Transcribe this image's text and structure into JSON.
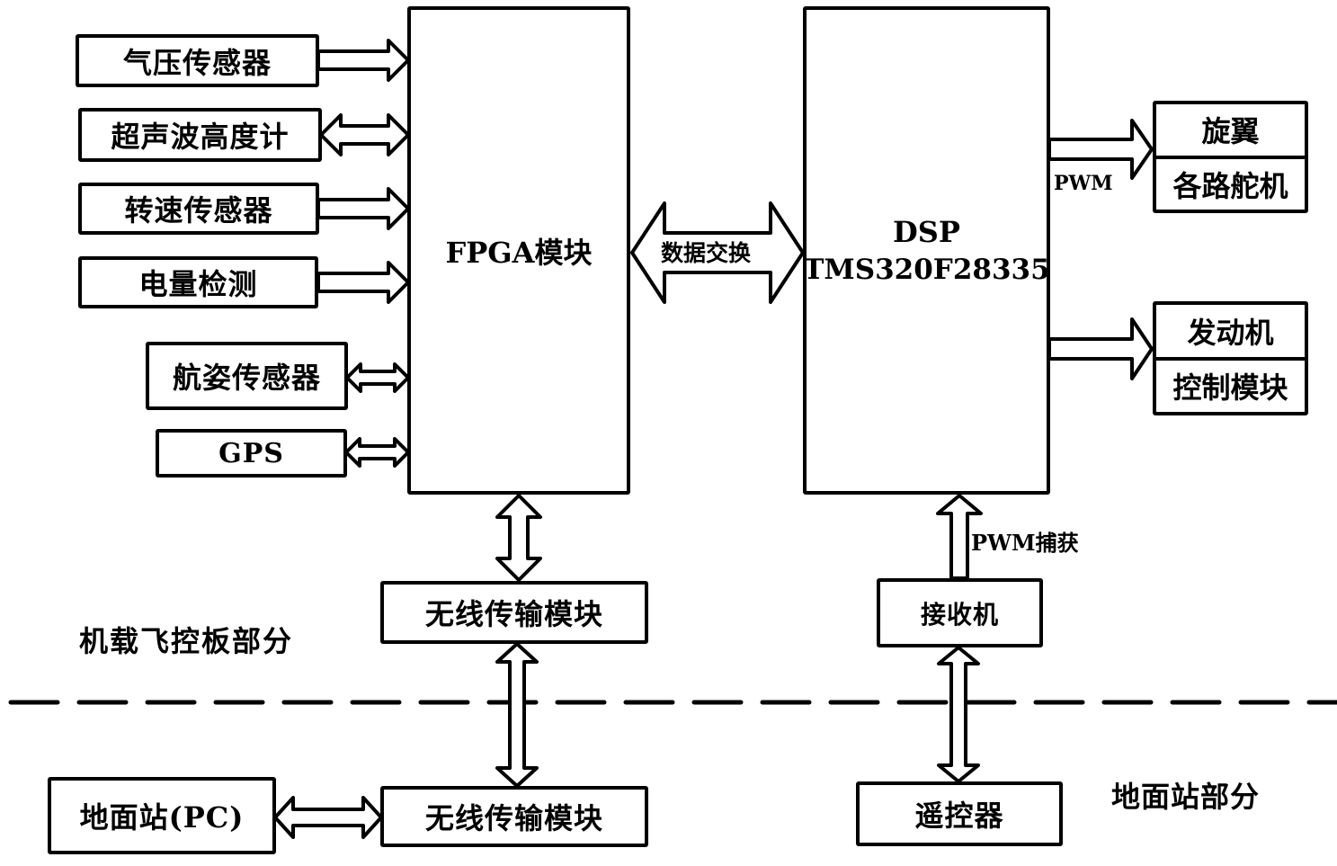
{
  "sections": {
    "onboard": "机载飞控板部分",
    "ground": "地面站部分"
  },
  "sensors": [
    {
      "label": "气压传感器",
      "link": "input"
    },
    {
      "label": "超声波高度计",
      "link": "bidirectional"
    },
    {
      "label": "转速传感器",
      "link": "input"
    },
    {
      "label": "电量检测",
      "link": "input"
    },
    {
      "label": "航姿传感器",
      "link": "bidirectional"
    },
    {
      "label": "GPS",
      "link": "bidirectional"
    }
  ],
  "fpga": {
    "label": "FPGA模块"
  },
  "data_exchange": {
    "label": "数据交换",
    "link": "bidirectional"
  },
  "dsp": {
    "line1": "DSP",
    "line2": "TMS320F28335"
  },
  "outputs": [
    {
      "line1": "旋翼",
      "line2": "各路舵机",
      "signal": "PWM",
      "link": "output"
    },
    {
      "line1": "发动机",
      "line2": "控制模块",
      "link": "output"
    }
  ],
  "onboard_wireless": {
    "label": "无线传输模块"
  },
  "receiver": {
    "label": "接收机",
    "signal": "PWM捕获"
  },
  "ground_station": {
    "label": "地面站(PC)"
  },
  "ground_wireless": {
    "label": "无线传输模块"
  },
  "remote_controller": {
    "label": "遥控器"
  }
}
